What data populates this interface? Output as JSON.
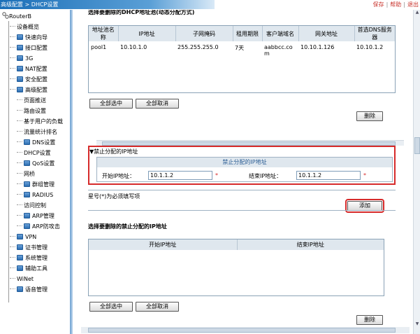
{
  "breadcrumb": "高级配置 > DHCP设置",
  "toplinks": [
    "保存",
    "帮助",
    "退出"
  ],
  "sidebar": {
    "root": "RouterB",
    "items": [
      {
        "label": "设备概览",
        "icon": false
      },
      {
        "label": "快速向导",
        "icon": true
      },
      {
        "label": "接口配置",
        "icon": true
      },
      {
        "label": "3G",
        "icon": true
      },
      {
        "label": "NAT配置",
        "icon": true
      },
      {
        "label": "安全配置",
        "icon": true
      },
      {
        "label": "高级配置",
        "icon": true
      },
      {
        "label": "页面推送",
        "icon": false
      },
      {
        "label": "路由设置",
        "icon": false
      },
      {
        "label": "基于用户的负载",
        "icon": false
      },
      {
        "label": "流量统计排名",
        "icon": false
      },
      {
        "label": "DNS设置",
        "icon": true
      },
      {
        "label": "DHCP设置",
        "icon": false
      },
      {
        "label": "QoS设置",
        "icon": true
      },
      {
        "label": "网桥",
        "icon": false
      },
      {
        "label": "群组管理",
        "icon": true
      },
      {
        "label": "RADIUS",
        "icon": true
      },
      {
        "label": "访问控制",
        "icon": false
      },
      {
        "label": "ARP管理",
        "icon": true
      },
      {
        "label": "ARP防攻击",
        "icon": true
      },
      {
        "label": "VPN",
        "icon": true
      },
      {
        "label": "证书管理",
        "icon": true
      },
      {
        "label": "系统管理",
        "icon": true
      },
      {
        "label": "辅助工具",
        "icon": true
      },
      {
        "label": "WiNet",
        "icon": false
      },
      {
        "label": "语音管理",
        "icon": true
      }
    ]
  },
  "pool_section": {
    "title": "选择要删除的DHCP地址池(动态分配方式)",
    "headers": [
      "地址池名称",
      "IP地址",
      "子网掩码",
      "租用期限",
      "客户端域名",
      "网关地址",
      "首选DNS服务器"
    ],
    "rows": [
      [
        "pool1",
        "10.10.1.0",
        "255.255.255.0",
        "7天",
        "aabbcc.com",
        "10.10.1.126",
        "10.10.1.2"
      ]
    ],
    "select_all": "全部选中",
    "deselect_all": "全部取消",
    "delete": "删除"
  },
  "forbid_section": {
    "title": "▼禁止分配的IP地址",
    "inner_title": "禁止分配的IP地址",
    "start_label": "开始IP地址：",
    "start_value": "10.1.1.2",
    "end_label": "结束IP地址：",
    "end_value": "10.1.1.2",
    "star": "*",
    "note": "星号(*)为必须填写项",
    "add": "添加"
  },
  "forbid_delete_section": {
    "title": "选择要删除的禁止分配的IP地址",
    "headers": [
      "开始IP地址",
      "结束IP地址"
    ],
    "select_all": "全部选中",
    "deselect_all": "全部取消",
    "delete": "删除"
  }
}
